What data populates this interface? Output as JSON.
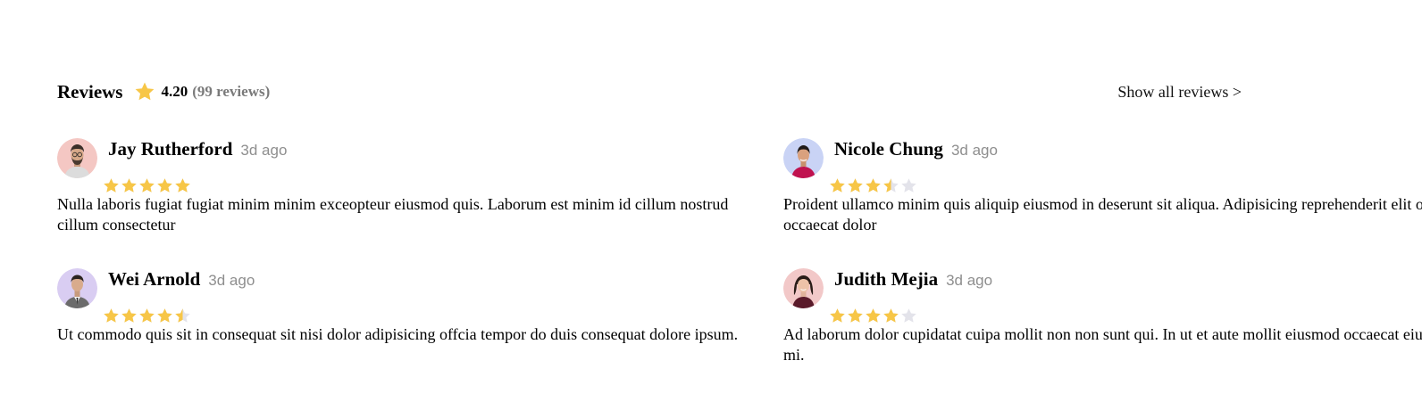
{
  "header": {
    "title": "Reviews",
    "rating": "4.20",
    "review_count": "(99 reviews)",
    "show_all_label": "Show all reviews >"
  },
  "colors": {
    "star_filled": "#f7c647",
    "star_empty": "#e3e3ea",
    "date_gray": "#8e8e8e"
  },
  "reviews": [
    {
      "name": "Jay Rutherford",
      "date": "3d ago",
      "rating": 5,
      "avatar_bg": "#f4c7c3",
      "text": "Nulla laboris fugiat fugiat minim minim exceopteur eiusmod quis. Laborum est minim id cillum nostrud cillum consectetur"
    },
    {
      "name": "Nicole Chung",
      "date": "3d ago",
      "rating": 3.5,
      "avatar_bg": "#c9d3f5",
      "text": "Proident ullamco minim quis aliquip eiusmod in deserunt sit aliqua. Adipisicing reprehenderit elit offcia occaecat dolor"
    },
    {
      "name": "Wei Arnold",
      "date": "3d ago",
      "rating": 4.5,
      "avatar_bg": "#d9cdf2",
      "text": "Ut commodo quis sit in consequat sit nisi dolor adipisicing offcia tempor do duis consequat dolore ipsum."
    },
    {
      "name": "Judith Mejia",
      "date": "3d ago",
      "rating": 4,
      "avatar_bg": "#f2c8c8",
      "text": "Ad laborum dolor cupidatat cuipa mollit non non sunt qui. In ut et aute mollit eiusmod occaecat eiusmod mi."
    }
  ]
}
